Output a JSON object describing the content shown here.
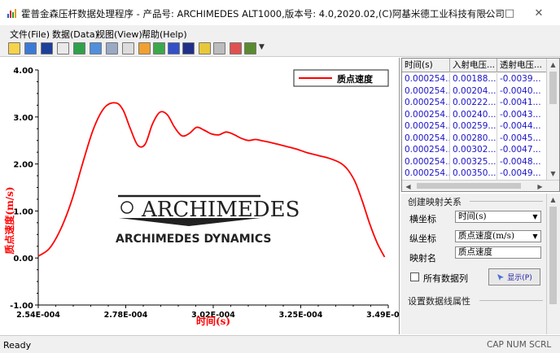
{
  "window": {
    "title": "霍普金森压杆数据处理程序 - 产品号: ARCHIMEDES ALT1000,版本号: 4.0,2020.02,(C)阿基米德工业科技有限公司",
    "icon": "app-chart-icon"
  },
  "menu": [
    {
      "label": "文件(File)"
    },
    {
      "label": "数据(Data)"
    },
    {
      "label": "视图(View)"
    },
    {
      "label": "帮助(Help)"
    }
  ],
  "toolbar": {
    "buttons": [
      "open-icon",
      "save-icon",
      "disk-icon",
      "page-icon",
      "import-icon",
      "table-icon",
      "chart-icon",
      "grid-icon",
      "zoom-icon",
      "refresh-icon",
      "window-icon",
      "book-icon",
      "help-icon",
      "print-icon",
      "edit-icon",
      "color-icon",
      "dropdown-icon"
    ]
  },
  "chart_data": {
    "type": "line",
    "xlabel": "时间(s)",
    "ylabel": "质点速度(m/s)",
    "xticks": [
      "2.54E-004",
      "2.78E-004",
      "3.02E-004",
      "3.25E-004",
      "3.49E-004"
    ],
    "yticks": [
      "4.00",
      "3.00",
      "2.00",
      "1.00",
      "0.00",
      "-1.00"
    ],
    "xlim": [
      0.000254,
      0.000349
    ],
    "ylim": [
      -1.0,
      4.0
    ],
    "grid": false,
    "legend_position": "top-right",
    "series": [
      {
        "name": "质点速度",
        "color": "#ff0000",
        "x": [
          0.000254,
          0.000257,
          0.00026,
          0.000263,
          0.000266,
          0.000269,
          0.000272,
          0.000275,
          0.000277,
          0.000279,
          0.000281,
          0.000283,
          0.000285,
          0.000287,
          0.000289,
          0.000291,
          0.000293,
          0.000295,
          0.000297,
          0.000299,
          0.000301,
          0.000303,
          0.000305,
          0.000307,
          0.000309,
          0.000311,
          0.000313,
          0.000315,
          0.000318,
          0.000321,
          0.000324,
          0.000327,
          0.00033,
          0.000333,
          0.000336,
          0.000338,
          0.00034,
          0.000342,
          0.000344,
          0.000346,
          0.000348
        ],
        "y": [
          0.04,
          0.2,
          0.6,
          1.2,
          2.0,
          2.75,
          3.2,
          3.3,
          3.15,
          2.75,
          2.4,
          2.42,
          2.85,
          3.1,
          3.05,
          2.78,
          2.6,
          2.65,
          2.78,
          2.72,
          2.64,
          2.62,
          2.68,
          2.63,
          2.55,
          2.5,
          2.52,
          2.49,
          2.44,
          2.38,
          2.32,
          2.24,
          2.18,
          2.12,
          2.02,
          1.88,
          1.62,
          1.2,
          0.72,
          0.32,
          0.02
        ]
      }
    ]
  },
  "watermark": {
    "logo_text": "ARCHIMEDES",
    "company": "ARCHIMEDES DYNAMICS"
  },
  "grid": {
    "columns": [
      "时间(s)",
      "入射电压...",
      "透射电压..."
    ],
    "rows": [
      [
        "0.000254...",
        "0.00188...",
        "-0.0039..."
      ],
      [
        "0.000254...",
        "0.00204...",
        "-0.0040..."
      ],
      [
        "0.000254...",
        "0.00222...",
        "-0.0041..."
      ],
      [
        "0.000254...",
        "0.00240...",
        "-0.0043..."
      ],
      [
        "0.000254...",
        "0.00259...",
        "-0.0044..."
      ],
      [
        "0.000254...",
        "0.00280...",
        "-0.0045..."
      ],
      [
        "0.000254...",
        "0.00302...",
        "-0.0047..."
      ],
      [
        "0.000254...",
        "0.00325...",
        "-0.0048..."
      ],
      [
        "0.000254...",
        "0.00350...",
        "-0.0049..."
      ]
    ]
  },
  "mapping": {
    "section_title": "创建映射关系",
    "x_label": "横坐标",
    "x_value": "时间(s)",
    "y_label": "纵坐标",
    "y_value": "质点速度(m/s)",
    "name_label": "映射名",
    "name_value": "质点速度",
    "all_columns_label": "所有数据列",
    "show_button": "显示(P)",
    "line_props_title": "设置数据线属性"
  },
  "status": {
    "text": "Ready",
    "indicators": "CAP NUM SCRL"
  }
}
